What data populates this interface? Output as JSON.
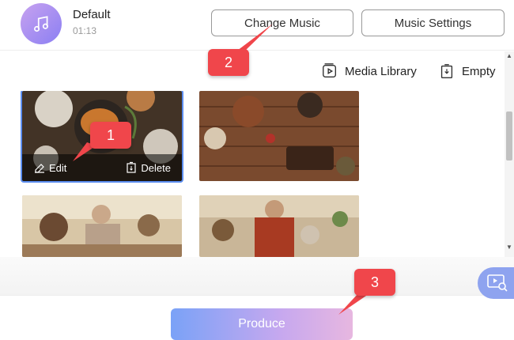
{
  "music": {
    "track_name": "Default",
    "duration": "01:13",
    "change_label": "Change Music",
    "settings_label": "Music Settings"
  },
  "toolbar": {
    "library_label": "Media Library",
    "empty_label": "Empty"
  },
  "media": {
    "items": [
      {
        "edit_label": "Edit",
        "delete_label": "Delete"
      }
    ]
  },
  "footer": {
    "produce_label": "Produce"
  },
  "callouts": [
    "1",
    "2",
    "3"
  ],
  "colors": {
    "callout": "#f0464b",
    "selection": "#5b8def",
    "produce_gradient_start": "#7aa2f7",
    "produce_gradient_end": "#e7b7e0"
  },
  "icons": {
    "music": "music-note-icon",
    "library": "media-library-icon",
    "empty": "trash-icon",
    "edit": "eraser-icon",
    "delete": "trash-icon",
    "preview": "preview-magnifier-icon"
  }
}
